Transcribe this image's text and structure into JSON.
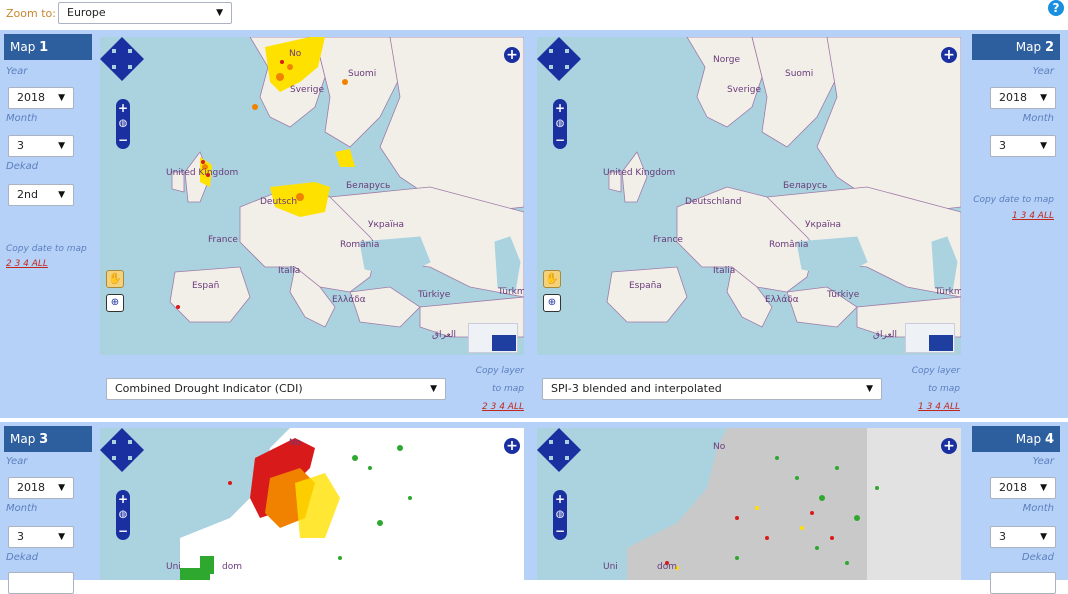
{
  "toolbar": {
    "zoom_label": "Zoom to:",
    "zoom_value": "Europe"
  },
  "help_icon": "?",
  "maps": [
    {
      "title": "Map",
      "number": "1",
      "year_label": "Year",
      "year": "2018",
      "month_label": "Month",
      "month": "3",
      "dekad_label": "Dekad",
      "dekad": "2nd",
      "copy_date_label": "Copy date to map",
      "copy_date_links": "2 3 4 ALL",
      "layer": "Combined Drought Indicator (CDI)",
      "copy_layer_label_1": "Copy layer",
      "copy_layer_label_2": "to map",
      "copy_layer_links": "2 3 4 ALL"
    },
    {
      "title": "Map",
      "number": "2",
      "year_label": "Year",
      "year": "2018",
      "month_label": "Month",
      "month": "3",
      "copy_date_label": "Copy date to map",
      "copy_date_links": "1 3 4 ALL",
      "layer": "SPI-3 blended and interpolated",
      "copy_layer_label_1": "Copy layer",
      "copy_layer_label_2": "to map",
      "copy_layer_links": "1 3 4 ALL"
    },
    {
      "title": "Map",
      "number": "3",
      "year_label": "Year",
      "year": "2018",
      "month_label": "Month",
      "month": "3",
      "dekad_label": "Dekad"
    },
    {
      "title": "Map",
      "number": "4",
      "year_label": "Year",
      "year": "2018",
      "month_label": "Month",
      "month": "3",
      "dekad_label": "Dekad"
    }
  ],
  "map_labels": {
    "norge": "Norge",
    "norge_short": "No",
    "suomi": "Suomi",
    "sverige": "Sverige",
    "uk": "United Kingdom",
    "uk_partial_1": "Uni",
    "uk_partial_2": "dom",
    "belarus": "Беларусь",
    "deutschland": "Deutschland",
    "deutsch_partial": "Deutsch",
    "ukraine": "Україна",
    "france": "France",
    "romania": "România",
    "italia": "Italia",
    "espana": "España",
    "espana_partial": "Españ",
    "ellada": "Ελλάδα",
    "turkiye": "Türkiye",
    "turkmen": "Türkme",
    "iraq": "العراق"
  }
}
